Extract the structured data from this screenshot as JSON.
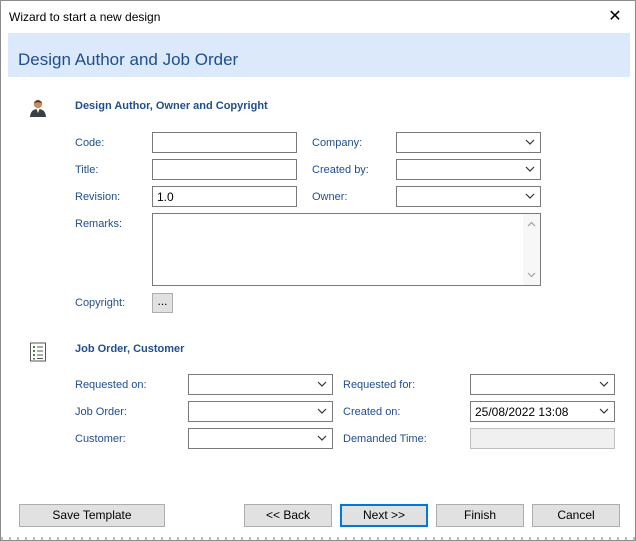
{
  "window": {
    "title": "Wizard to start a new design"
  },
  "header": {
    "title": "Design Author and Job Order"
  },
  "author_section": {
    "title": "Design Author, Owner and Copyright",
    "code_label": "Code:",
    "code_value": "",
    "title_label": "Title:",
    "title_value": "",
    "revision_label": "Revision:",
    "revision_value": "1.0",
    "remarks_label": "Remarks:",
    "remarks_value": "",
    "copyright_label": "Copyright:",
    "copyright_button": "...",
    "company_label": "Company:",
    "company_value": "",
    "created_by_label": "Created by:",
    "created_by_value": "",
    "owner_label": "Owner:",
    "owner_value": ""
  },
  "job_section": {
    "title": "Job Order, Customer",
    "requested_on_label": "Requested on:",
    "requested_on_value": "",
    "job_order_label": "Job Order:",
    "job_order_value": "",
    "customer_label": "Customer:",
    "customer_value": "",
    "requested_for_label": "Requested for:",
    "requested_for_value": "",
    "created_on_label": "Created on:",
    "created_on_value": "25/08/2022 13:08",
    "demanded_time_label": "Demanded Time:",
    "demanded_time_value": ""
  },
  "buttons": {
    "save_template": "Save Template",
    "back": "<< Back",
    "next": "Next >>",
    "finish": "Finish",
    "cancel": "Cancel"
  },
  "icons": {
    "close": "close-icon",
    "author": "person-icon",
    "job": "checklist-icon"
  },
  "colors": {
    "accent": "#1f4e8c",
    "header_band": "#dbe9fb",
    "default_button_border": "#0078d7"
  }
}
